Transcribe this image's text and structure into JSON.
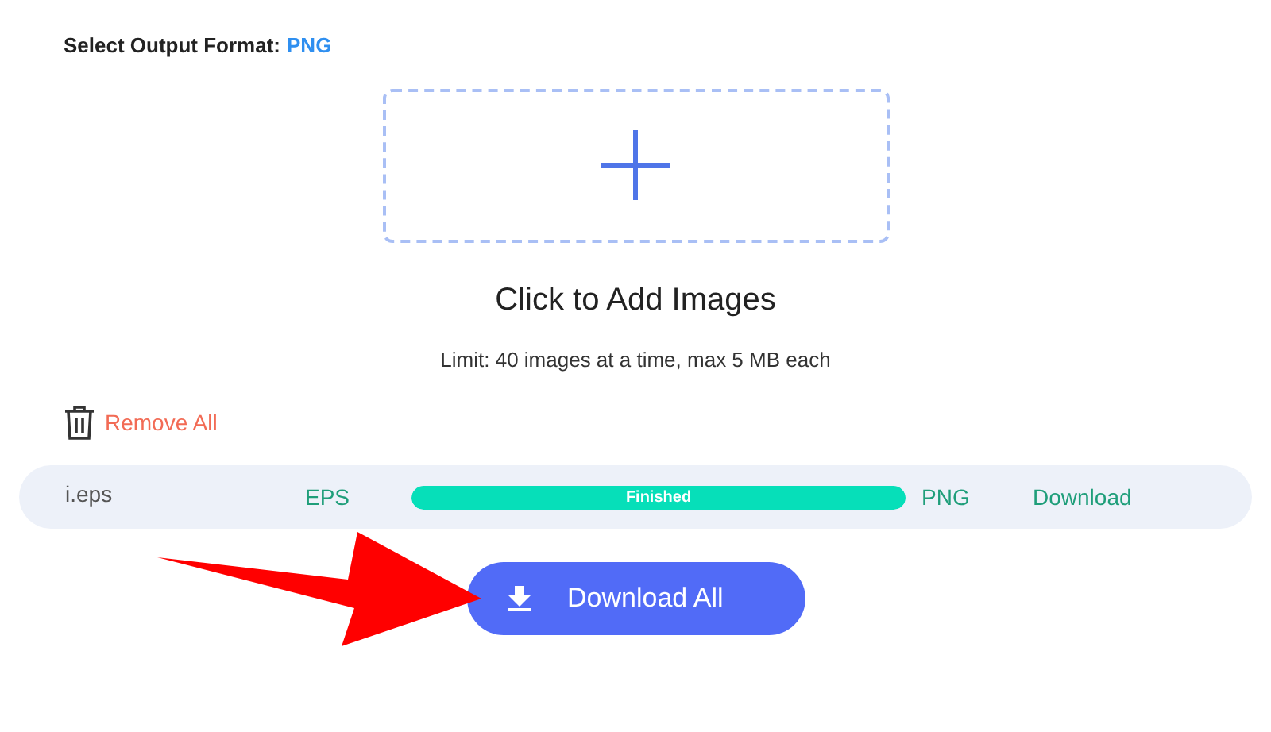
{
  "output_format": {
    "label": "Select Output Format:",
    "value": "PNG"
  },
  "upload": {
    "title": "Click to Add Images",
    "limit": "Limit: 40 images at a time, max 5 MB each"
  },
  "remove_all": "Remove All",
  "files": [
    {
      "name": "i.eps",
      "from": "EPS",
      "status": "Finished",
      "level": 1,
      "to": "PNG",
      "action": "Download"
    }
  ],
  "download_all": "Download All"
}
